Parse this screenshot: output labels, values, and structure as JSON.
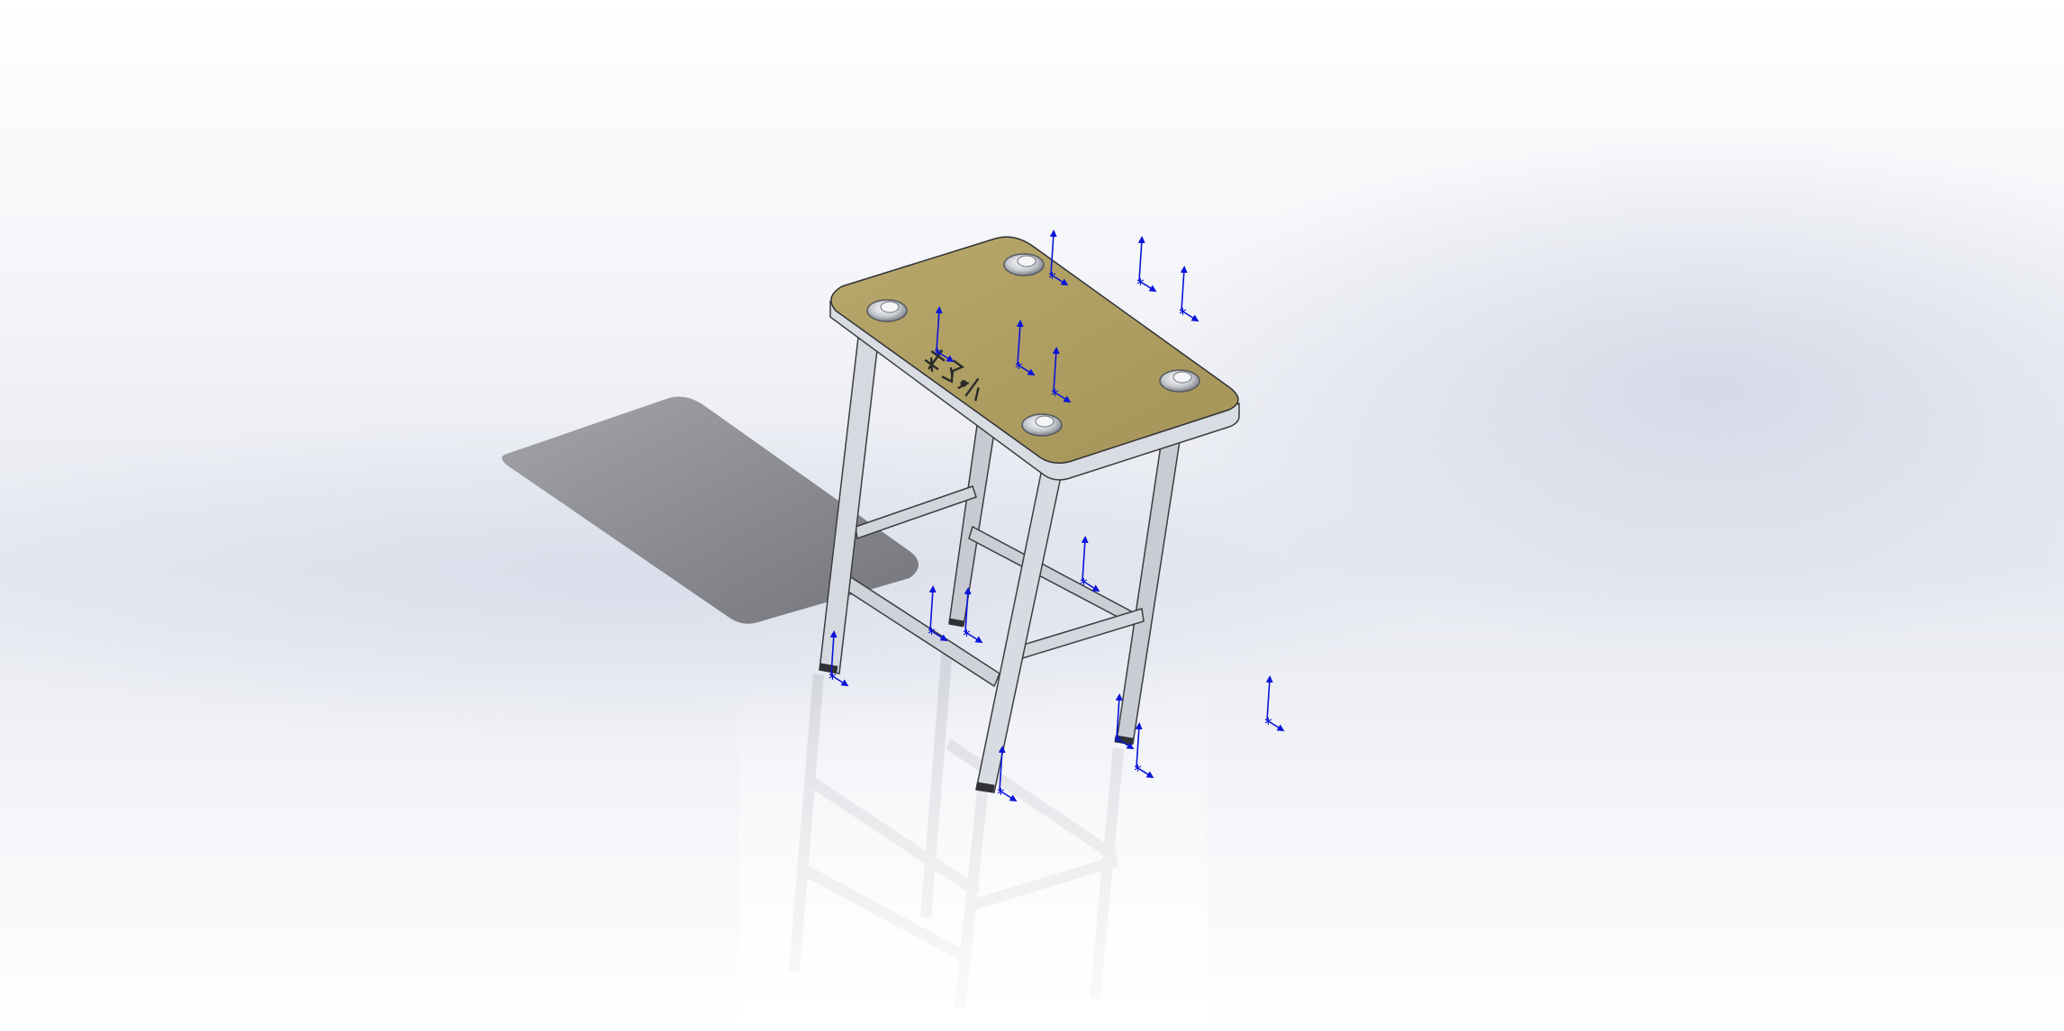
{
  "viewport": {
    "label": "SolidWorks graphics area",
    "background": "#eef0f6",
    "shadow_color": "#8c8d92"
  },
  "model": {
    "name": "stool-assembly",
    "seat_color": "#ad9c62",
    "frame_color": "#cfd2d8",
    "engraving_text": "泰迪·小"
  },
  "icons": {
    "triad": "coordinate-triad-icon",
    "mate": "mate-point-icon",
    "bolt": "bolt-head-icon"
  },
  "colors": {
    "triad_blue": "#0a14d8"
  }
}
